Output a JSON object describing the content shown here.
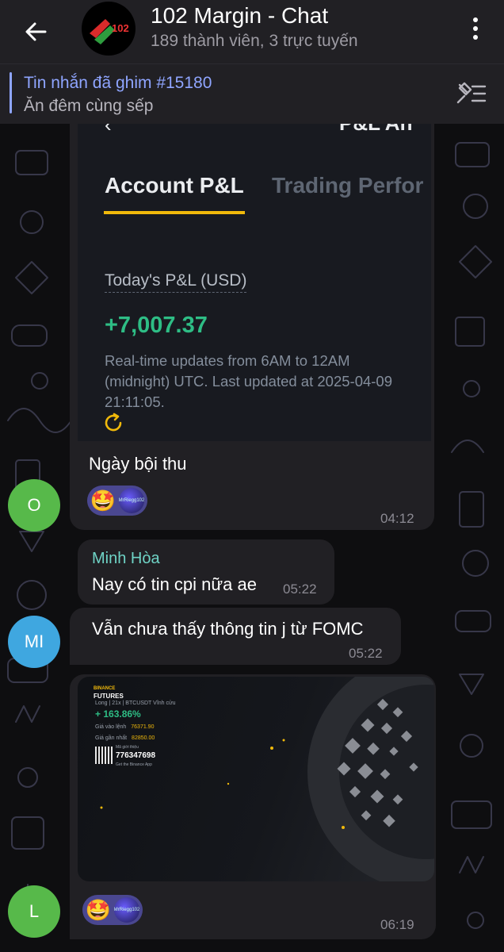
{
  "header": {
    "title": "102 Margin - Chat",
    "subtitle": "189 thành viên, 3 trực tuyến",
    "logo_text": "102"
  },
  "pinned": {
    "title": "Tin nhắn đã ghim #15180",
    "text": "Ăn đêm cùng sếp"
  },
  "messages": [
    {
      "sender_initial": "O",
      "avatar_color": "#57b94a",
      "image": {
        "tab_active": "Account P&L",
        "tab_other": "Trading Perfor",
        "header_partial": "P&L An",
        "label": "Today's P&L (USD)",
        "value": "+7,007.37",
        "note": "Real-time updates from 6AM to 12AM (midnight) UTC. Last updated at 2025-04-09 21:11:05."
      },
      "text": "Ngày bội thu",
      "reaction_emoji": "🤩",
      "reaction_avatar_text": "MrRiegg102",
      "time": "04:12"
    },
    {
      "sender_initial": "MI",
      "avatar_color": "#3fa7e0",
      "sender_name": "Minh Hòa",
      "text": "Nay có tin cpi nữa ae",
      "time": "05:22"
    },
    {
      "text": "Vẫn chưa thấy thông tin j từ FOMC",
      "time": "05:22"
    },
    {
      "sender_initial": "L",
      "avatar_color": "#57b94a",
      "image": {
        "brand_top": "BINANCE",
        "brand": "FUTURES",
        "position_line": "Long | 21x | BTCUSDT Vĩnh cửu",
        "pnl": "+ 163.86%",
        "entry_label": "Giá vào lệnh",
        "entry_value": "76371.90",
        "last_label": "Giá gần nhất",
        "last_value": "82850.00",
        "ref_label": "Mã giới thiệu",
        "ref_code": "776347698",
        "app_text": "Get the Binance App"
      },
      "reaction_emoji": "🤩",
      "reaction_avatar_text": "MrRiegg102",
      "time": "06:19"
    }
  ]
}
